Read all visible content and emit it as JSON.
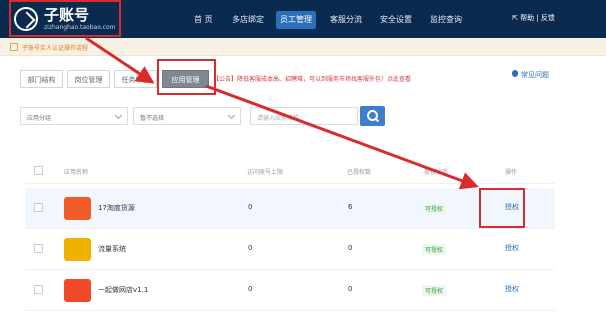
{
  "header": {
    "logo_title": "子账号",
    "logo_subtitle": "zizhanghao.taobao.com",
    "nav": [
      {
        "label": "首  页",
        "active": false
      },
      {
        "label": "多店绑定",
        "active": false
      },
      {
        "label": "员工管理",
        "active": true
      },
      {
        "label": "客服分流",
        "active": false
      },
      {
        "label": "安全设置",
        "active": false
      },
      {
        "label": "监控查询",
        "active": false
      }
    ],
    "help_label": "帮助 | 反馈"
  },
  "notice": {
    "text": "子账号实人认证操作流程"
  },
  "tabs": [
    {
      "label": "部门结构",
      "active": false
    },
    {
      "label": "岗位管理",
      "active": false
    },
    {
      "label": "任务审核",
      "active": false
    },
    {
      "label": "应用管理",
      "active": true
    }
  ],
  "announcement": "【公告】降低客服成本高、招聘难，可以到服务市场找客服外包！点此查看",
  "faq_label": "常见问题",
  "filters": {
    "app_select": "应用分组",
    "status_select": "暂不选择",
    "search_placeholder": "请输入应用名称"
  },
  "table": {
    "headers": [
      "应用名称",
      "访问账号上限",
      "已授权数",
      "授权状态",
      "操作"
    ],
    "rows": [
      {
        "name": "17淘度货源",
        "limit": "0",
        "authorized": "6",
        "status": "可授权",
        "action": "授权",
        "icon_color": "#f25c2b"
      },
      {
        "name": "流量系统",
        "limit": "0",
        "authorized": "0",
        "status": "可授权",
        "action": "授权",
        "icon_color": "#f0b100"
      },
      {
        "name": "一起做网店v1.1",
        "limit": "0",
        "authorized": "0",
        "status": "可授权",
        "action": "授权",
        "icon_color": "#f04a2b"
      }
    ]
  },
  "colors": {
    "topbar": "#0b2a4f",
    "accent": "#2a6fba",
    "highlight": "#d82b2b",
    "success": "#2fa24b"
  }
}
